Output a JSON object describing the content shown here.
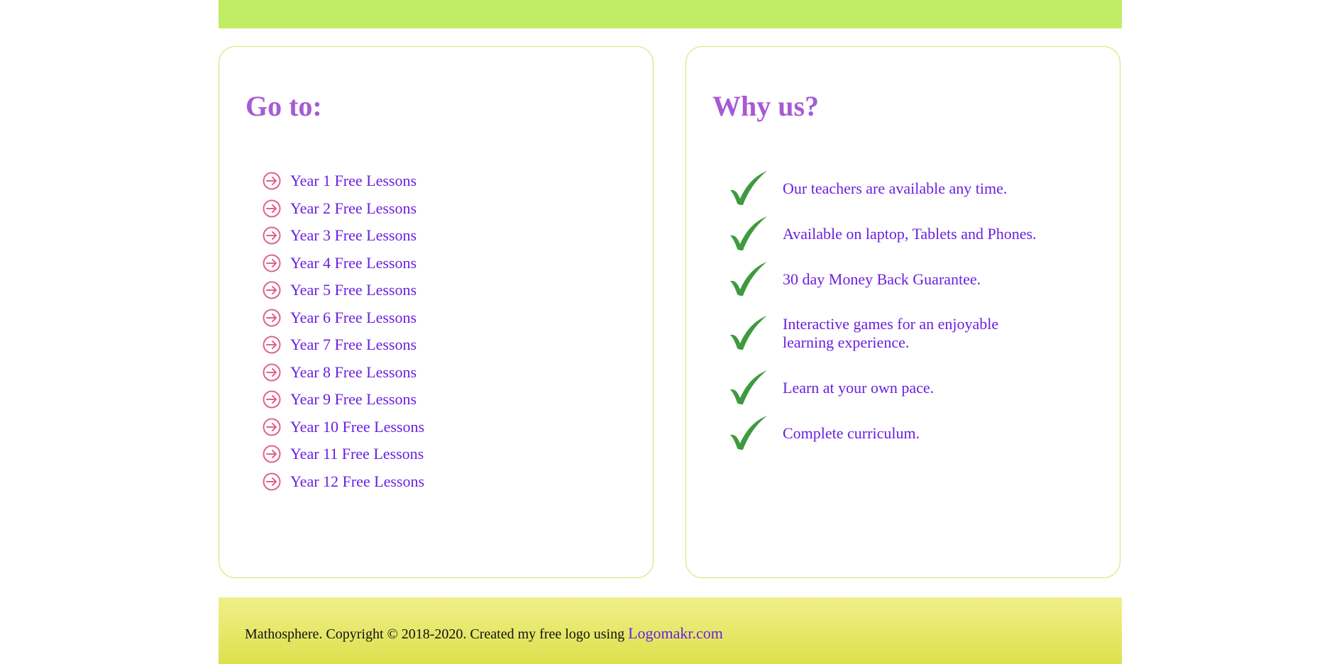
{
  "colors": {
    "top_bar": "#c0ec66",
    "card_border": "#c0ec66",
    "heading": "#a65ad6",
    "link": "#6a1fe0",
    "arrow_icon": "#e0638a",
    "check_icon": "#3f9a3f",
    "footer_gradient_top": "#f0f08a",
    "footer_gradient_bottom": "#dde04c"
  },
  "goto": {
    "title": "Go to:",
    "icon": "circle-arrow-right-icon",
    "items": [
      {
        "label": "Year 1 Free Lessons"
      },
      {
        "label": "Year 2 Free Lessons"
      },
      {
        "label": "Year 3 Free Lessons"
      },
      {
        "label": "Year 4 Free Lessons"
      },
      {
        "label": "Year 5 Free Lessons"
      },
      {
        "label": "Year 6 Free Lessons"
      },
      {
        "label": "Year 7 Free Lessons"
      },
      {
        "label": "Year 8 Free Lessons"
      },
      {
        "label": "Year 9 Free Lessons"
      },
      {
        "label": "Year 10 Free Lessons"
      },
      {
        "label": "Year 11 Free Lessons"
      },
      {
        "label": "Year 12 Free Lessons"
      }
    ]
  },
  "why": {
    "title": "Why us?",
    "icon": "checkmark-icon",
    "items": [
      {
        "text": "Our teachers are available any time."
      },
      {
        "text": "Available on laptop, Tablets and Phones."
      },
      {
        "text": "30 day Money Back Guarantee."
      },
      {
        "text": "Interactive games for an enjoyable learning experience."
      },
      {
        "text": "Learn at your own pace."
      },
      {
        "text": "Complete curriculum."
      }
    ]
  },
  "footer": {
    "text": "Mathosphere. Copyright © 2018-2020. Created my free logo using ",
    "link_label": "Logomakr.com"
  }
}
